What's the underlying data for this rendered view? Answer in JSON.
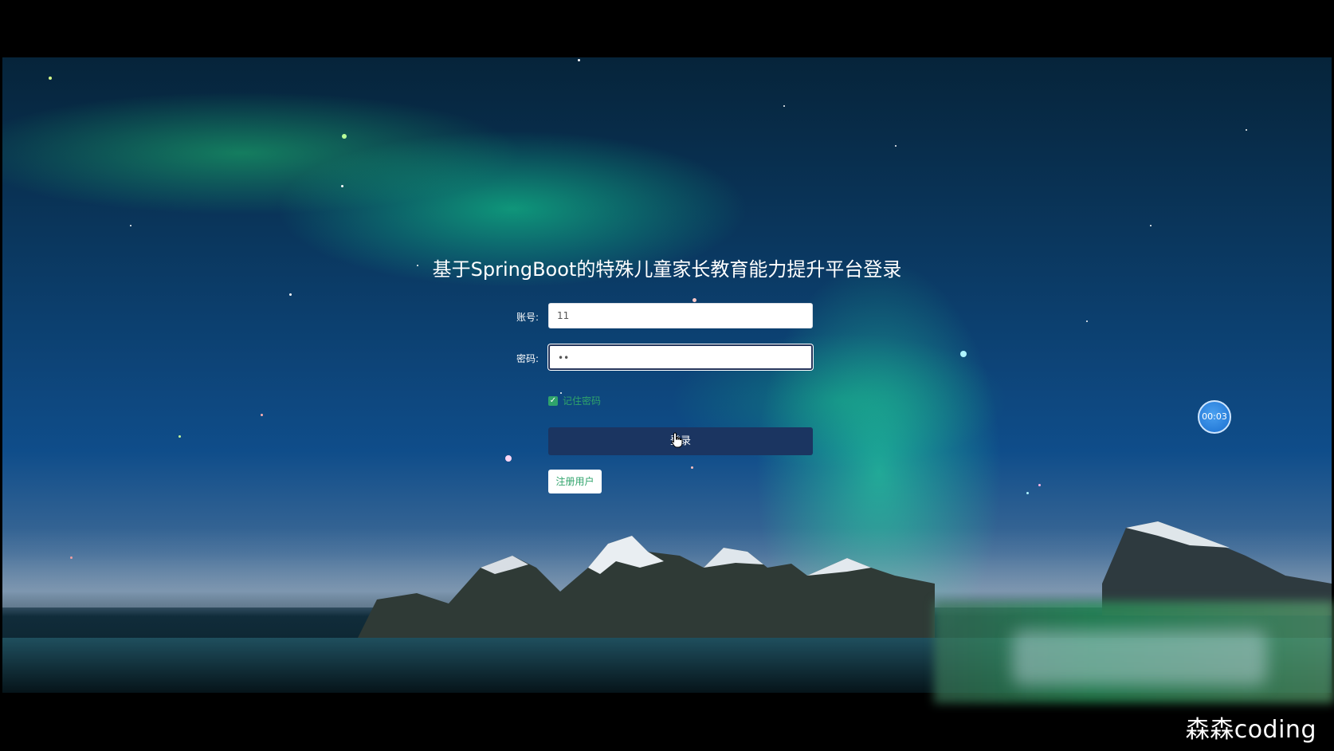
{
  "page": {
    "title": "基于SpringBoot的特殊儿童家长教育能力提升平台登录"
  },
  "form": {
    "account_label": "账号:",
    "account_value": "11",
    "password_label": "密码:",
    "password_value": "••",
    "remember_label": "记住密码",
    "remember_checked": true,
    "login_label": "登录",
    "register_label": "注册用户"
  },
  "recorder": {
    "timer": "00:03"
  },
  "overlay": {
    "brand": "森森coding"
  },
  "colors": {
    "primary_button": "#1b3561",
    "accent_green": "#2fa36b",
    "timer_blue": "#1a6fd0"
  },
  "icons": {
    "checkbox": "check-icon",
    "cursor": "hand-pointer-icon"
  }
}
